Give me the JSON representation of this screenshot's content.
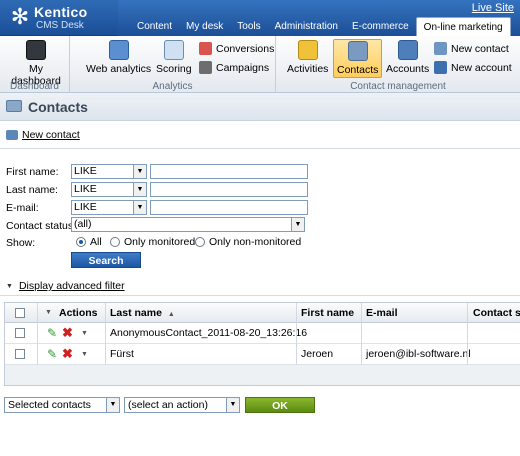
{
  "app": {
    "brand": "Kentico",
    "product": "CMS Desk",
    "live_site": "Live Site"
  },
  "nav": {
    "tabs": [
      "Content",
      "My desk",
      "Tools",
      "Administration",
      "E-commerce",
      "On-line marketing"
    ],
    "active": "On-line marketing"
  },
  "ribbon": {
    "groups": {
      "dashboard": "Dashboard",
      "analytics": "Analytics",
      "contact_management": "Contact management"
    },
    "items": {
      "my_dashboard": "My dashboard",
      "web_analytics": "Web analytics",
      "scoring": "Scoring",
      "conversions": "Conversions",
      "campaigns": "Campaigns",
      "activities": "Activities",
      "contacts": "Contacts",
      "accounts": "Accounts",
      "new_contact": "New contact",
      "new_account": "New account"
    }
  },
  "page": {
    "title": "Contacts",
    "new_contact_link": "New contact"
  },
  "filter": {
    "first_name_label": "First name:",
    "last_name_label": "Last name:",
    "email_label": "E-mail:",
    "status_label": "Contact status:",
    "show_label": "Show:",
    "op_first": "LIKE",
    "op_last": "LIKE",
    "op_email": "LIKE",
    "status_value": "(all)",
    "show_all": "All",
    "show_monitored": "Only monitored",
    "show_non_monitored": "Only non-monitored",
    "show_selected": "All",
    "search_button": "Search",
    "advanced_link": "Display advanced filter"
  },
  "grid": {
    "columns": [
      "Actions",
      "Last name",
      "First name",
      "E-mail",
      "Contact sta"
    ],
    "sort_indicator": "▲",
    "rows": [
      {
        "last_name": "AnonymousContact_2011-08-20_13:26:16",
        "first_name": "",
        "email": ""
      },
      {
        "last_name": "Fürst",
        "first_name": "Jeroen",
        "email": "jeroen@ibl-software.nl"
      }
    ]
  },
  "bulk": {
    "scope": "Selected contacts",
    "action": "(select an action)",
    "ok_button": "OK"
  },
  "colors": {
    "header_blue": "#1c4f96",
    "ok_green": "#5b8a12",
    "search_blue": "#1d57a3",
    "active_orange": "#ffcd5a"
  }
}
